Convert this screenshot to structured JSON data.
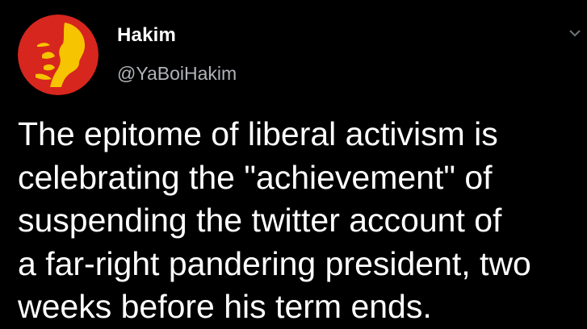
{
  "author": {
    "display_name": "Hakim",
    "handle": "@YaBoiHakim",
    "avatar_icon": "red-portrait-avatar-icon"
  },
  "menu": {
    "icon": "chevron-down-icon"
  },
  "tweet": {
    "text": "The epitome of liberal activism is\ncelebrating the \"achievement\" of\nsuspending the twitter account of\na far-right pandering president, two\nweeks before his term ends."
  },
  "colors": {
    "background": "#000000",
    "name": "#ffffff",
    "handle": "#b0b3b8",
    "avatar_red": "#d7261e",
    "avatar_yellow": "#f6c400"
  }
}
